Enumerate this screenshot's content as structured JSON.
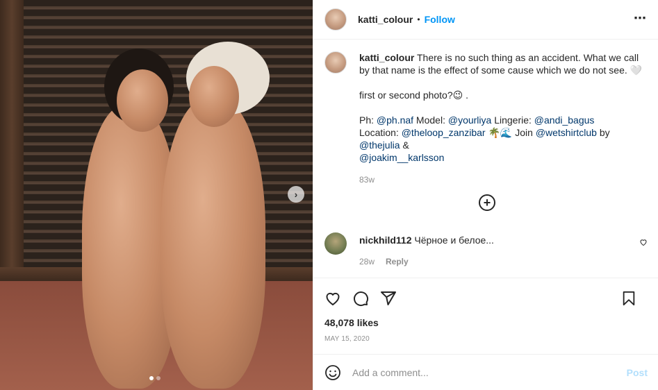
{
  "post": {
    "username": "katti_colour",
    "follow_label": "Follow",
    "separator": "•",
    "more_icon": "⋯"
  },
  "caption": {
    "username": "katti_colour",
    "line1": "There is no such thing as an accident. What we call by that name is the effect of some cause which we do not see. 🤍",
    "line2": "first or second photo?😉 .",
    "ph_label": "Ph: ",
    "ph_tag": "@ph.naf",
    "model_label": " Model: ",
    "model_tag": "@yourliya",
    "lingerie_label": " Lingerie: ",
    "lingerie_tag": "@andi_bagus",
    "location_label": "Location: ",
    "location_tag": "@theloop_zanzibar",
    "location_emoji": " 🌴🌊 ",
    "join_label": "Join ",
    "join_tag": "@wetshirtclub",
    "by_label": " by ",
    "by_tag": "@thejulia",
    "amp": " & ",
    "last_tag": "@joakim__karlsson",
    "time": "83w"
  },
  "comment": {
    "username": "nickhild112",
    "text": "Чёрное и белое...",
    "time": "28w",
    "reply_label": "Reply"
  },
  "actions": {
    "likes": "48,078 likes",
    "date": "MAY 15, 2020"
  },
  "add_comment": {
    "placeholder": "Add a comment...",
    "post_label": "Post"
  },
  "icons": {
    "heart": "heart-icon",
    "comment": "comment-icon",
    "share": "share-icon",
    "bookmark": "bookmark-icon",
    "emoji": "emoji-icon",
    "add": "plus-circle-icon",
    "next": "chevron-right-icon"
  },
  "colors": {
    "accent": "#0095f6",
    "tag": "#00376b",
    "muted": "#8e8e8e",
    "post_disabled": "#b2dffc"
  },
  "carousel": {
    "slide_count": 2,
    "active_index": 0
  }
}
